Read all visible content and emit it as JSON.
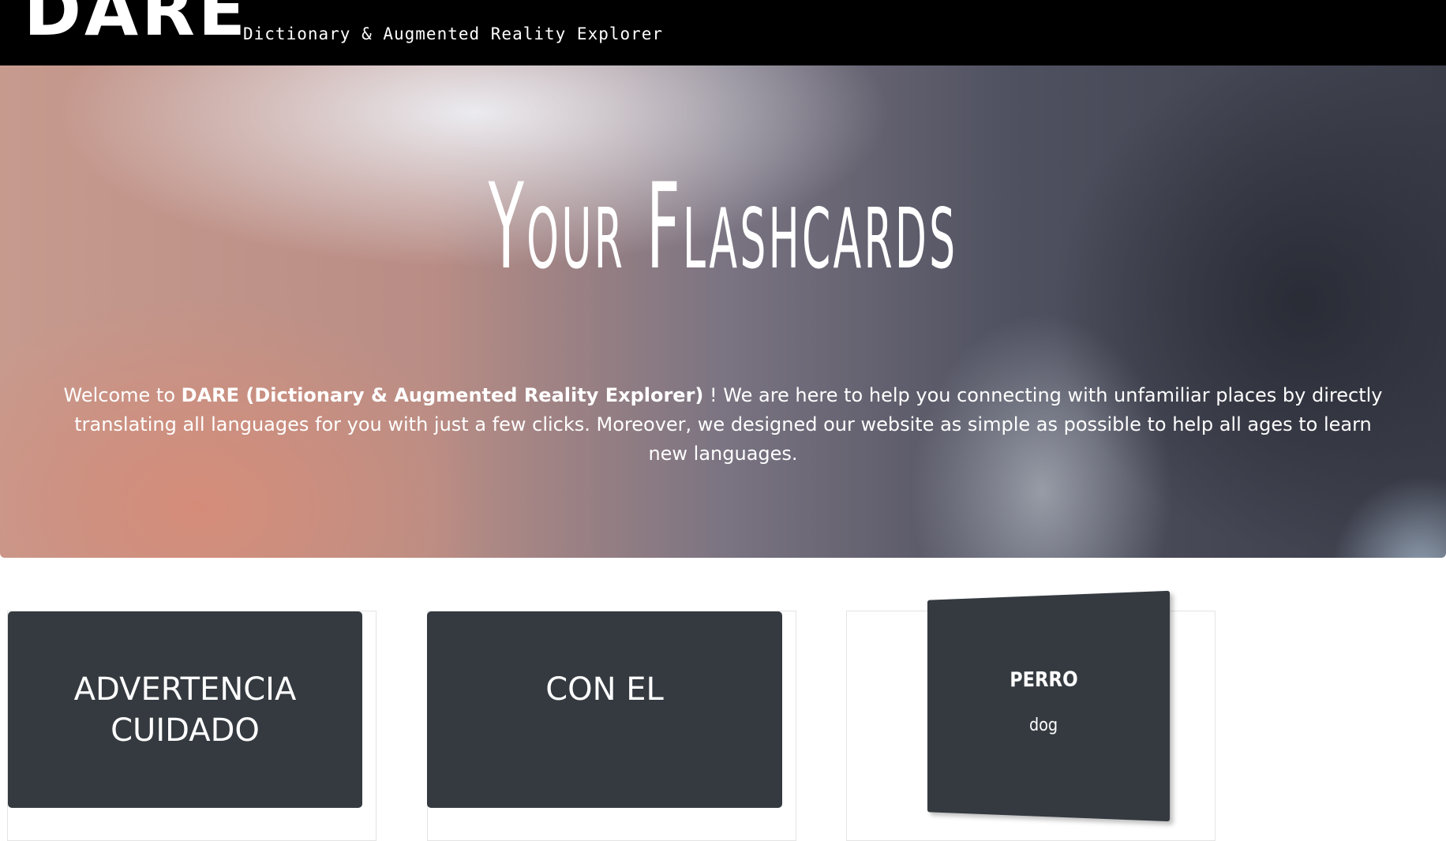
{
  "header": {
    "logo": "DARE",
    "tagline": "Dictionary & Augmented Reality Explorer"
  },
  "hero": {
    "title": "Your Flashcards",
    "welcome_prefix": "Welcome to ",
    "welcome_brand": "DARE (Dictionary & Augmented Reality Explorer)",
    "welcome_suffix": " ! We are here to help you connecting with unfamiliar places by directly translating all languages for you with just a few clicks. Moreover, we designed our website as simple as possible to help all ages to learn new languages."
  },
  "flashcards": [
    {
      "line1": "ADVERTENCIA",
      "line2": "CUIDADO"
    },
    {
      "line1": "CON EL",
      "line2": ""
    },
    {
      "word": "PERRO",
      "translation": "dog"
    }
  ],
  "colors": {
    "navbar": "#000000",
    "card": "#343a40",
    "text_light": "#ffffff"
  }
}
